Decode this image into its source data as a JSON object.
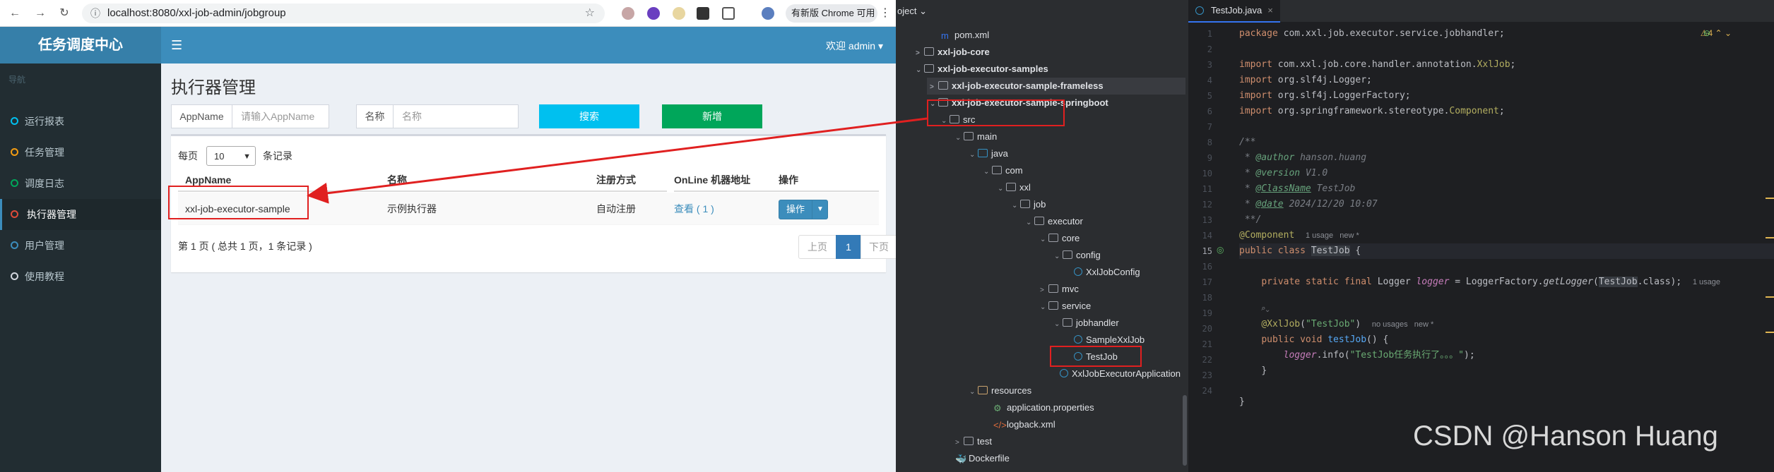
{
  "browser": {
    "url": "localhost:8080/xxl-job-admin/jobgroup",
    "update_label": "有新版 Chrome 可用",
    "accent": "#3c8dbc"
  },
  "app": {
    "logo": "任务调度中心",
    "user": "欢迎 admin",
    "nav_header": "导航",
    "nav": [
      {
        "label": "运行报表",
        "color": "#00c0ef"
      },
      {
        "label": "任务管理",
        "color": "#f39c12"
      },
      {
        "label": "调度日志",
        "color": "#00a65a"
      },
      {
        "label": "执行器管理",
        "color": "#dd4b39"
      },
      {
        "label": "用户管理",
        "color": "#3c8dbc"
      },
      {
        "label": "使用教程",
        "color": "#d2d6de"
      }
    ]
  },
  "page": {
    "title": "执行器管理",
    "appname_label": "AppName",
    "appname_placeholder": "请输入AppName",
    "name_label": "名称",
    "name_placeholder": "名称",
    "search_btn": "搜索",
    "add_btn": "新增",
    "per_page_prefix": "每页",
    "per_page_value": "10",
    "per_page_suffix": "条记录",
    "columns": [
      "AppName",
      "名称",
      "注册方式",
      "OnLine 机器地址",
      "操作"
    ],
    "row": {
      "appname": "xxl-job-executor-sample",
      "name": "示例执行器",
      "reg": "自动注册",
      "online": "查看 ( 1 )",
      "op": "操作"
    },
    "page_info": "第 1 页 ( 总共 1 页，1 条记录 )",
    "prev": "上页",
    "current": "1",
    "next": "下页"
  },
  "project": {
    "header": "oject",
    "items": [
      {
        "label": "pom.xml",
        "kind": "file"
      },
      {
        "label": "xxl-job-core",
        "kind": "module"
      },
      {
        "label": "xxl-job-executor-samples",
        "kind": "module"
      },
      {
        "label": "xxl-job-executor-sample-frameless",
        "kind": "module"
      },
      {
        "label": "xxl-job-executor-sample-springboot",
        "kind": "module"
      },
      {
        "label": "src",
        "kind": "folder"
      },
      {
        "label": "main",
        "kind": "folder"
      },
      {
        "label": "java",
        "kind": "folder"
      },
      {
        "label": "com",
        "kind": "folder"
      },
      {
        "label": "xxl",
        "kind": "folder"
      },
      {
        "label": "job",
        "kind": "folder"
      },
      {
        "label": "executor",
        "kind": "folder"
      },
      {
        "label": "core",
        "kind": "folder"
      },
      {
        "label": "config",
        "kind": "folder"
      },
      {
        "label": "XxlJobConfig",
        "kind": "class"
      },
      {
        "label": "mvc",
        "kind": "folder"
      },
      {
        "label": "service",
        "kind": "folder"
      },
      {
        "label": "jobhandler",
        "kind": "folder"
      },
      {
        "label": "SampleXxlJob",
        "kind": "class"
      },
      {
        "label": "TestJob",
        "kind": "class"
      },
      {
        "label": "XxlJobExecutorApplication",
        "kind": "class"
      },
      {
        "label": "resources",
        "kind": "folder"
      },
      {
        "label": "application.properties",
        "kind": "file"
      },
      {
        "label": "logback.xml",
        "kind": "file"
      },
      {
        "label": "test",
        "kind": "folder"
      },
      {
        "label": "Dockerfile",
        "kind": "file"
      }
    ]
  },
  "editor": {
    "tab": "TestJob.java",
    "warnings": "4",
    "line_numbers": [
      "1",
      "2",
      "3",
      "4",
      "5",
      "6",
      "7",
      "8",
      "9",
      "10",
      "11",
      "12",
      "13",
      "14",
      "15",
      "16",
      "17",
      "18",
      "19",
      "20",
      "21",
      "22",
      "23",
      "24"
    ],
    "code": {
      "l1_kw": "package",
      "l1_rest": " com.xxl.job.executor.service.jobhandler;",
      "l3_kw": "import",
      "l3_a": " com.xxl.job.core.handler.annotation.",
      "l3_b": "XxlJob",
      "l3_c": ";",
      "l4_rest": " org.slf4j.Logger;",
      "l5_rest": " org.slf4j.LoggerFactory;",
      "l6_a": " org.springframework.stereotype.",
      "l6_b": "Component",
      "l6_c": ";",
      "l8": "/**",
      "l9_a": " * ",
      "l9_tag": "@author",
      "l9_b": " hanson.huang",
      "l10_tag": "@version",
      "l10_b": " V1.0",
      "l11_tag": "@ClassName",
      "l11_b": " TestJob",
      "l12_tag": "@date",
      "l12_b": " 2024/12/20 10:07",
      "l13": " **/",
      "l14_ann": "@Component",
      "l14_hint": "1 usage   new *",
      "l15_kw": "public class ",
      "l15_name": "TestJob",
      "l15_rest": " {",
      "l17_kw": "private static final ",
      "l17_a": "Logger ",
      "l17_fld": "logger",
      "l17_b": " = LoggerFactory.",
      "l17_fn": "getLogger",
      "l17_c": "(",
      "l17_sel": "TestJob",
      "l17_d": ".class);",
      "l17_hint": "1 usage",
      "l18_hint": "⌕⌄",
      "l19_ann": "@XxlJob",
      "l19_a": "(",
      "l19_str": "\"TestJob\"",
      "l19_b": ")",
      "l19_hint": "no usages   new *",
      "l20_kw": "public void ",
      "l20_fn": "testJob",
      "l20_rest": "() {",
      "l21_fld": "logger",
      "l21_a": ".info(",
      "l21_str": "\"TestJob任务执行了。。。\"",
      "l21_b": ");",
      "l22": "}",
      "l24": "}"
    }
  },
  "watermark": "CSDN @Hanson Huang"
}
